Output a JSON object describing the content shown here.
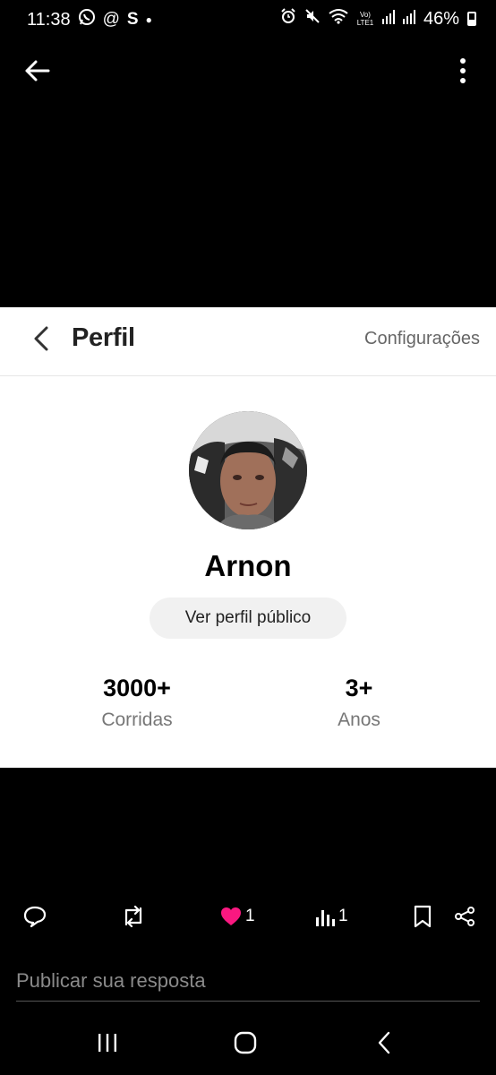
{
  "status_bar": {
    "time": "11:38",
    "left_icons": [
      "whatsapp-icon",
      "at-icon",
      "s-icon",
      "dot-icon"
    ],
    "s_label": "S",
    "right_icons": [
      "alarm-icon",
      "mute-icon",
      "wifi-icon",
      "volte-icon",
      "signal-icon",
      "signal-icon"
    ],
    "volte_label": "Vo) LTE1",
    "battery": "46%"
  },
  "embed": {
    "header": {
      "title": "Perfil",
      "settings": "Configurações"
    },
    "profile": {
      "name": "Arnon",
      "public_button": "Ver perfil público"
    },
    "stats": [
      {
        "value": "3000+",
        "label": "Corridas"
      },
      {
        "value": "3+",
        "label": "Anos"
      }
    ]
  },
  "actions": {
    "likes": "1",
    "views": "1",
    "like_color": "#f91880"
  },
  "reply": {
    "placeholder": "Publicar sua resposta"
  }
}
